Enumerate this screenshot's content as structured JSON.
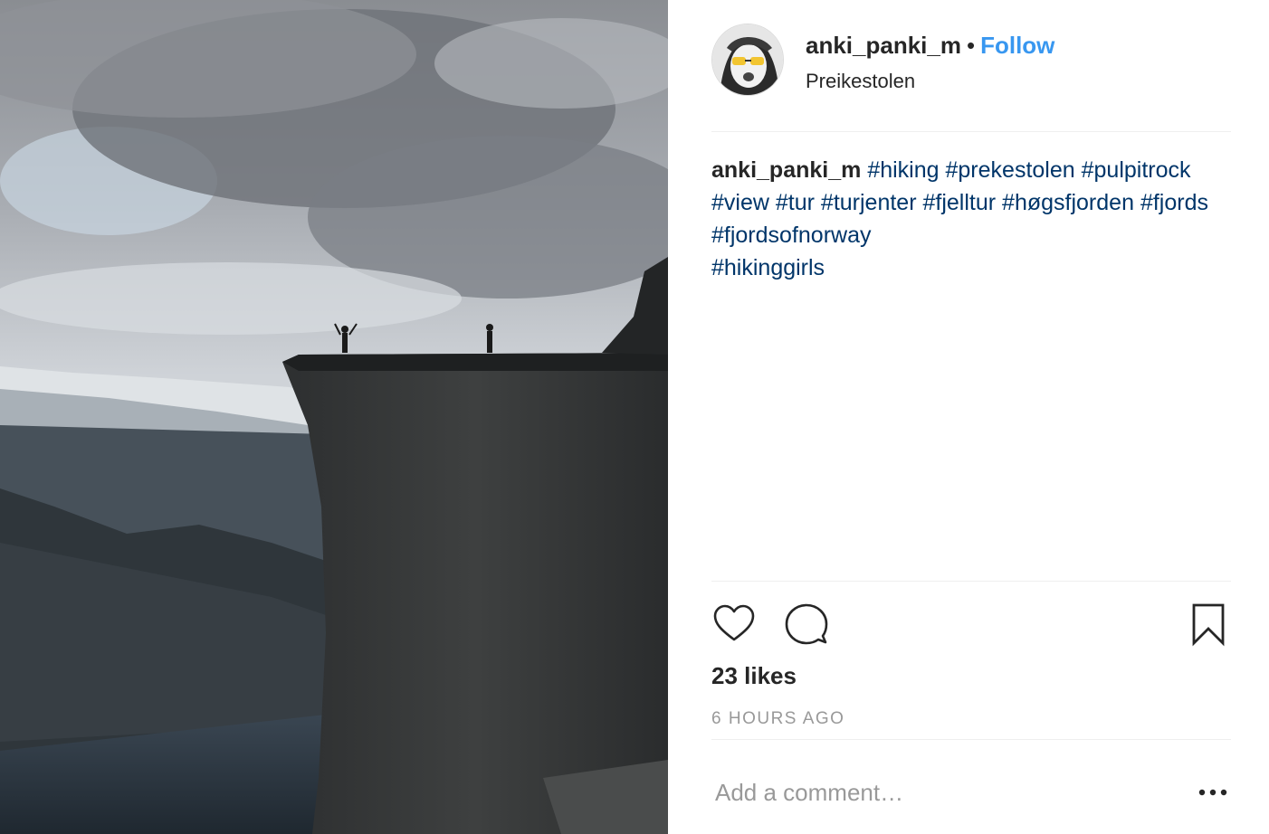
{
  "post": {
    "image_alt": "Preikestolen cliff with hikers above a fjord",
    "author": "anki_panki_m",
    "separator": "•",
    "follow_label": "Follow",
    "location": "Preikestolen"
  },
  "caption": {
    "username": "anki_panki_m",
    "hashtags": [
      "#hiking",
      "#prekestolen",
      "#pulpitrock",
      "#view",
      "#tur",
      "#turjenter",
      "#fjelltur",
      "#høgsfjorden",
      "#fjords",
      "#fjordsofnorway",
      "#hikinggirls"
    ]
  },
  "actions": {
    "like_icon": "heart-icon",
    "comment_icon": "comment-bubble-icon",
    "save_icon": "bookmark-icon",
    "likes_text": "23 likes",
    "timestamp": "6 HOURS AGO"
  },
  "comment": {
    "placeholder": "Add a comment…",
    "more_icon": "ellipsis-icon"
  },
  "colors": {
    "follow": "#3897f0",
    "hashtag": "#003569",
    "muted": "#999999",
    "text": "#262626",
    "divider": "#efefef"
  }
}
